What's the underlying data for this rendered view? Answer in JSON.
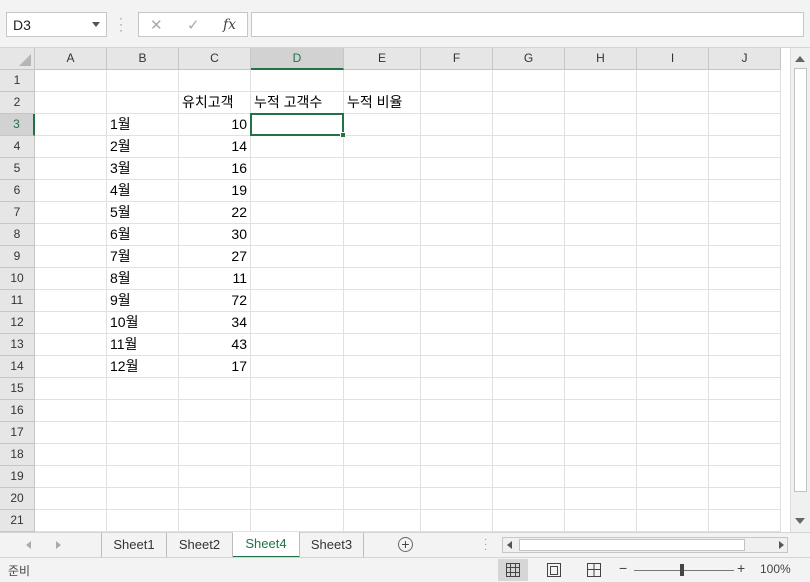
{
  "formula_bar": {
    "name_box": "D3",
    "cancel_icon": "✕",
    "enter_icon": "✓",
    "fx_label": "fx",
    "formula": ""
  },
  "columns": [
    "A",
    "B",
    "C",
    "D",
    "E",
    "F",
    "G",
    "H",
    "I",
    "J"
  ],
  "selected_column": "D",
  "rows": [
    "1",
    "2",
    "3",
    "4",
    "5",
    "6",
    "7",
    "8",
    "9",
    "10",
    "11",
    "12",
    "13",
    "14",
    "15",
    "16",
    "17",
    "18",
    "19",
    "20",
    "21"
  ],
  "selected_row": "3",
  "cells": {
    "C2": "유치고객",
    "D2": "누적 고객수",
    "E2": "누적 비율",
    "B3": "1월",
    "C3": "10",
    "B4": "2월",
    "C4": "14",
    "B5": "3월",
    "C5": "16",
    "B6": "4월",
    "C6": "19",
    "B7": "5월",
    "C7": "22",
    "B8": "6월",
    "C8": "30",
    "B9": "7월",
    "C9": "27",
    "B10": "8월",
    "C10": "11",
    "B11": "9월",
    "C11": "72",
    "B12": "10월",
    "C12": "34",
    "B13": "11월",
    "C13": "43",
    "B14": "12월",
    "C14": "17"
  },
  "numeric_cells": [
    "C3",
    "C4",
    "C5",
    "C6",
    "C7",
    "C8",
    "C9",
    "C10",
    "C11",
    "C12",
    "C13",
    "C14"
  ],
  "active_cell": "D3",
  "sheets": [
    {
      "label": "Sheet1",
      "active": false
    },
    {
      "label": "Sheet2",
      "active": false
    },
    {
      "label": "Sheet4",
      "active": true
    },
    {
      "label": "Sheet3",
      "active": false
    }
  ],
  "add_sheet_label": "+",
  "status": {
    "text": "준비",
    "zoom_minus": "−",
    "zoom_plus": "+",
    "zoom_level": "100%",
    "view": "normal"
  },
  "colors": {
    "accent": "#217346",
    "header_bg": "#e6e6e6",
    "gridline": "#e1e1e1"
  }
}
